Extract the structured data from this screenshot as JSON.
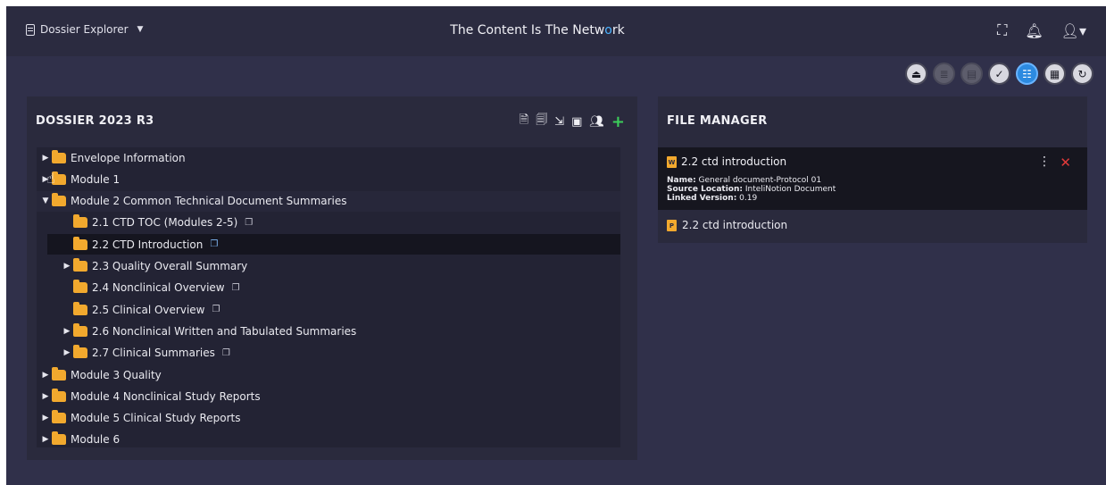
{
  "header": {
    "app_menu_label": "Dossier Explorer",
    "title_start": "The Content Is The Netw",
    "title_dot": "o",
    "title_end": "rk"
  },
  "icons": {
    "app": "document-icon",
    "fullscreen": "fullscreen-icon",
    "notifications": "bell-icon",
    "user": "user-icon",
    "toolbar": [
      "export-icon",
      "stack-icon",
      "clipboard-icon",
      "check-circle-icon",
      "tree-view-icon",
      "table-view-icon",
      "refresh-icon"
    ]
  },
  "colors": {
    "accent": "#2c8ae0",
    "folder": "#f2a92e",
    "add": "#3ccf5a",
    "close": "#e23a3a"
  },
  "dossier": {
    "title": "DOSSIER 2023 R3",
    "tree": [
      {
        "label": "Envelope Information",
        "level": 0,
        "expandable": true
      },
      {
        "label": "Module 1",
        "level": 0,
        "expandable": true
      },
      {
        "label": "Module 2 Common Technical Document Summaries",
        "level": 0,
        "expandable": true,
        "expanded": true,
        "highlighted": true
      },
      {
        "label": "2.1 CTD TOC (Modules 2-5)",
        "level": 1,
        "expandable": false,
        "copy": true
      },
      {
        "label": "2.2 CTD Introduction",
        "level": 1,
        "expandable": false,
        "copy": true,
        "selected": true
      },
      {
        "label": "2.3 Quality Overall Summary",
        "level": 1,
        "expandable": true
      },
      {
        "label": "2.4 Nonclinical Overview",
        "level": 1,
        "expandable": false,
        "copy": true
      },
      {
        "label": "2.5 Clinical Overview",
        "level": 1,
        "expandable": false,
        "copy": true
      },
      {
        "label": "2.6 Nonclinical Written and Tabulated Summaries",
        "level": 1,
        "expandable": true
      },
      {
        "label": "2.7 Clinical Summaries",
        "level": 1,
        "expandable": true,
        "copy": true
      },
      {
        "label": "Module 3 Quality",
        "level": 0,
        "expandable": true
      },
      {
        "label": "Module 4 Nonclinical Study Reports",
        "level": 0,
        "expandable": true
      },
      {
        "label": "Module 5 Clinical Study Reports",
        "level": 0,
        "expandable": true
      },
      {
        "label": "Module 6",
        "level": 0,
        "expandable": true
      }
    ]
  },
  "file_manager": {
    "title": "FILE MANAGER",
    "card": {
      "file_name": "2.2 ctd introduction",
      "name_label": "Name:",
      "name_value": " General document-Protocol 01",
      "source_label": "Source Location:",
      "source_value": " InteliNotion Document",
      "version_label": "Linked Version:",
      "version_value": " 0.19"
    },
    "pdf_file_name": "2.2 ctd introduction"
  }
}
